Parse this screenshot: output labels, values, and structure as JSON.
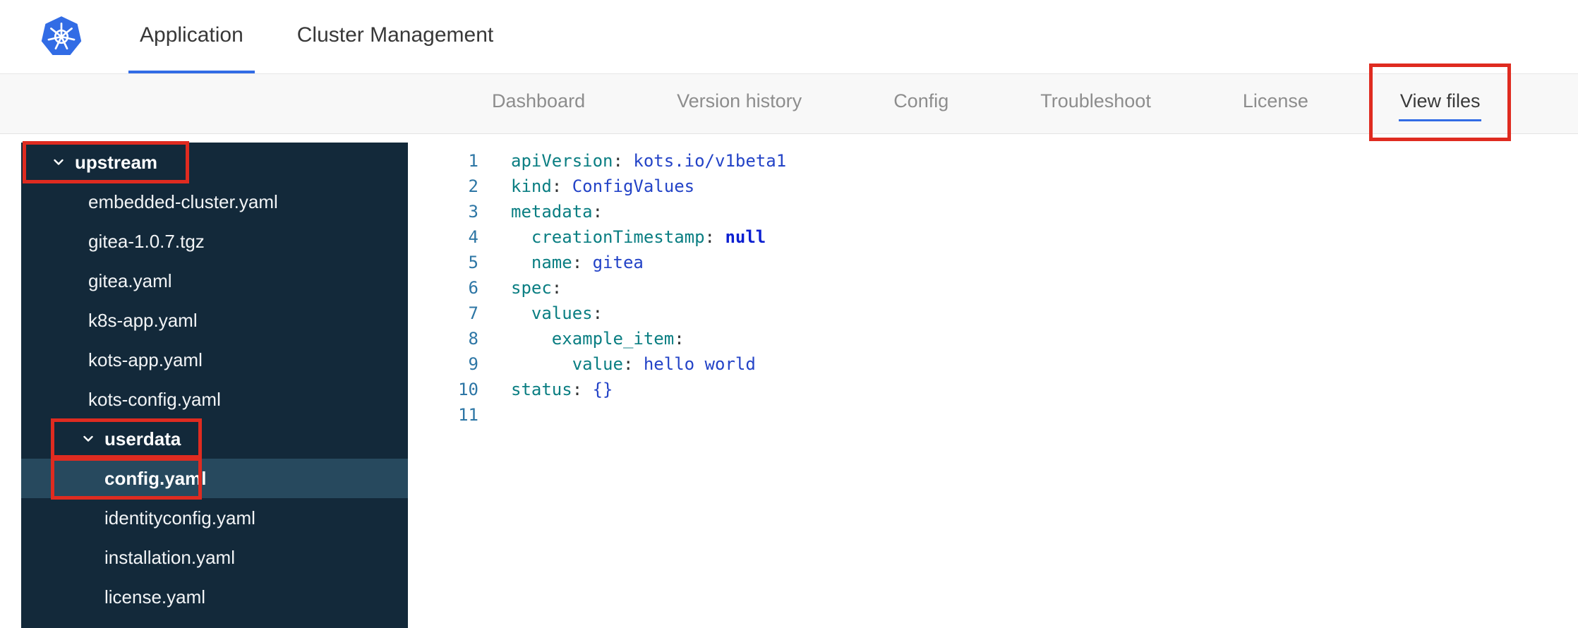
{
  "colors": {
    "accent_blue": "#326ce5",
    "sidebar_bg": "#13293a",
    "sidebar_selected": "#27495e",
    "annotation_red": "#df2b20",
    "syntax_key": "#0a7e82",
    "syntax_value": "#2343c7",
    "syntax_keyword": "#0b1fd1",
    "line_number": "#2d76a5"
  },
  "header": {
    "logo_icon": "kubernetes-logo",
    "tabs": [
      {
        "label": "Application",
        "active": true
      },
      {
        "label": "Cluster Management",
        "active": false
      }
    ]
  },
  "subnav": {
    "tabs": [
      {
        "label": "Dashboard",
        "active": false,
        "annotated": false
      },
      {
        "label": "Version history",
        "active": false,
        "annotated": false
      },
      {
        "label": "Config",
        "active": false,
        "annotated": false
      },
      {
        "label": "Troubleshoot",
        "active": false,
        "annotated": false
      },
      {
        "label": "License",
        "active": false,
        "annotated": false
      },
      {
        "label": "View files",
        "active": true,
        "annotated": true
      }
    ]
  },
  "file_tree": [
    {
      "kind": "folder",
      "label": "upstream",
      "level": 0,
      "expanded": true,
      "selected": false,
      "annotated": true
    },
    {
      "kind": "file",
      "label": "embedded-cluster.yaml",
      "level": 1,
      "selected": false,
      "annotated": false
    },
    {
      "kind": "file",
      "label": "gitea-1.0.7.tgz",
      "level": 1,
      "selected": false,
      "annotated": false
    },
    {
      "kind": "file",
      "label": "gitea.yaml",
      "level": 1,
      "selected": false,
      "annotated": false
    },
    {
      "kind": "file",
      "label": "k8s-app.yaml",
      "level": 1,
      "selected": false,
      "annotated": false
    },
    {
      "kind": "file",
      "label": "kots-app.yaml",
      "level": 1,
      "selected": false,
      "annotated": false
    },
    {
      "kind": "file",
      "label": "kots-config.yaml",
      "level": 1,
      "selected": false,
      "annotated": false
    },
    {
      "kind": "folder",
      "label": "userdata",
      "level": 1,
      "expanded": true,
      "selected": false,
      "annotated": true
    },
    {
      "kind": "file",
      "label": "config.yaml",
      "level": 2,
      "selected": true,
      "annotated": true
    },
    {
      "kind": "file",
      "label": "identityconfig.yaml",
      "level": 2,
      "selected": false,
      "annotated": false
    },
    {
      "kind": "file",
      "label": "installation.yaml",
      "level": 2,
      "selected": false,
      "annotated": false
    },
    {
      "kind": "file",
      "label": "license.yaml",
      "level": 2,
      "selected": false,
      "annotated": false
    }
  ],
  "editor": {
    "lines": [
      {
        "number": "1",
        "tokens": [
          [
            "key",
            "apiVersion"
          ],
          [
            "punct",
            ": "
          ],
          [
            "value",
            "kots.io/v1beta1"
          ]
        ]
      },
      {
        "number": "2",
        "tokens": [
          [
            "key",
            "kind"
          ],
          [
            "punct",
            ": "
          ],
          [
            "value",
            "ConfigValues"
          ]
        ]
      },
      {
        "number": "3",
        "tokens": [
          [
            "key",
            "metadata"
          ],
          [
            "punct",
            ":"
          ]
        ]
      },
      {
        "number": "4",
        "tokens": [
          [
            "plain",
            "  "
          ],
          [
            "key",
            "creationTimestamp"
          ],
          [
            "punct",
            ": "
          ],
          [
            "keyword",
            "null"
          ]
        ]
      },
      {
        "number": "5",
        "tokens": [
          [
            "plain",
            "  "
          ],
          [
            "key",
            "name"
          ],
          [
            "punct",
            ": "
          ],
          [
            "value",
            "gitea"
          ]
        ]
      },
      {
        "number": "6",
        "tokens": [
          [
            "key",
            "spec"
          ],
          [
            "punct",
            ":"
          ]
        ]
      },
      {
        "number": "7",
        "tokens": [
          [
            "plain",
            "  "
          ],
          [
            "key",
            "values"
          ],
          [
            "punct",
            ":"
          ]
        ]
      },
      {
        "number": "8",
        "tokens": [
          [
            "plain",
            "    "
          ],
          [
            "key",
            "example_item"
          ],
          [
            "punct",
            ":"
          ]
        ]
      },
      {
        "number": "9",
        "tokens": [
          [
            "plain",
            "      "
          ],
          [
            "key",
            "value"
          ],
          [
            "punct",
            ": "
          ],
          [
            "value",
            "hello world"
          ]
        ]
      },
      {
        "number": "10",
        "tokens": [
          [
            "key",
            "status"
          ],
          [
            "punct",
            ": "
          ],
          [
            "value",
            "{}"
          ]
        ]
      },
      {
        "number": "11",
        "tokens": []
      }
    ]
  }
}
